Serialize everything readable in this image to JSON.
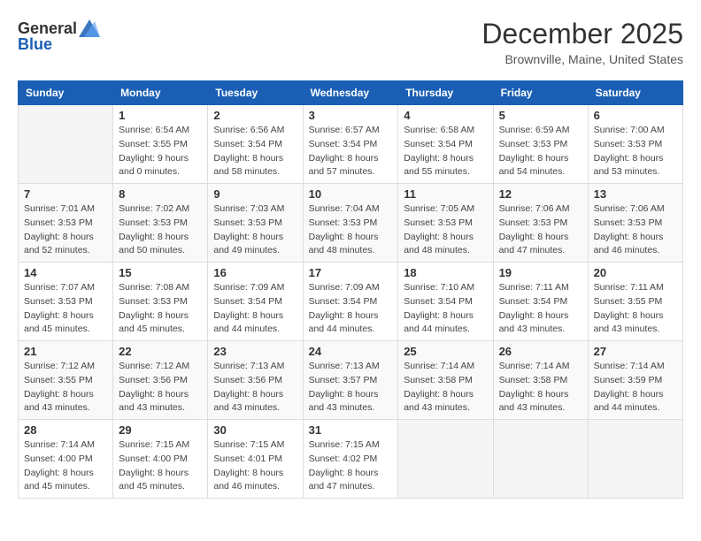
{
  "header": {
    "logo_line1": "General",
    "logo_line2": "Blue",
    "month": "December 2025",
    "location": "Brownville, Maine, United States"
  },
  "weekdays": [
    "Sunday",
    "Monday",
    "Tuesday",
    "Wednesday",
    "Thursday",
    "Friday",
    "Saturday"
  ],
  "weeks": [
    [
      {
        "day": "",
        "info": ""
      },
      {
        "day": "1",
        "info": "Sunrise: 6:54 AM\nSunset: 3:55 PM\nDaylight: 9 hours\nand 0 minutes."
      },
      {
        "day": "2",
        "info": "Sunrise: 6:56 AM\nSunset: 3:54 PM\nDaylight: 8 hours\nand 58 minutes."
      },
      {
        "day": "3",
        "info": "Sunrise: 6:57 AM\nSunset: 3:54 PM\nDaylight: 8 hours\nand 57 minutes."
      },
      {
        "day": "4",
        "info": "Sunrise: 6:58 AM\nSunset: 3:54 PM\nDaylight: 8 hours\nand 55 minutes."
      },
      {
        "day": "5",
        "info": "Sunrise: 6:59 AM\nSunset: 3:53 PM\nDaylight: 8 hours\nand 54 minutes."
      },
      {
        "day": "6",
        "info": "Sunrise: 7:00 AM\nSunset: 3:53 PM\nDaylight: 8 hours\nand 53 minutes."
      }
    ],
    [
      {
        "day": "7",
        "info": "Sunrise: 7:01 AM\nSunset: 3:53 PM\nDaylight: 8 hours\nand 52 minutes."
      },
      {
        "day": "8",
        "info": "Sunrise: 7:02 AM\nSunset: 3:53 PM\nDaylight: 8 hours\nand 50 minutes."
      },
      {
        "day": "9",
        "info": "Sunrise: 7:03 AM\nSunset: 3:53 PM\nDaylight: 8 hours\nand 49 minutes."
      },
      {
        "day": "10",
        "info": "Sunrise: 7:04 AM\nSunset: 3:53 PM\nDaylight: 8 hours\nand 48 minutes."
      },
      {
        "day": "11",
        "info": "Sunrise: 7:05 AM\nSunset: 3:53 PM\nDaylight: 8 hours\nand 48 minutes."
      },
      {
        "day": "12",
        "info": "Sunrise: 7:06 AM\nSunset: 3:53 PM\nDaylight: 8 hours\nand 47 minutes."
      },
      {
        "day": "13",
        "info": "Sunrise: 7:06 AM\nSunset: 3:53 PM\nDaylight: 8 hours\nand 46 minutes."
      }
    ],
    [
      {
        "day": "14",
        "info": "Sunrise: 7:07 AM\nSunset: 3:53 PM\nDaylight: 8 hours\nand 45 minutes."
      },
      {
        "day": "15",
        "info": "Sunrise: 7:08 AM\nSunset: 3:53 PM\nDaylight: 8 hours\nand 45 minutes."
      },
      {
        "day": "16",
        "info": "Sunrise: 7:09 AM\nSunset: 3:54 PM\nDaylight: 8 hours\nand 44 minutes."
      },
      {
        "day": "17",
        "info": "Sunrise: 7:09 AM\nSunset: 3:54 PM\nDaylight: 8 hours\nand 44 minutes."
      },
      {
        "day": "18",
        "info": "Sunrise: 7:10 AM\nSunset: 3:54 PM\nDaylight: 8 hours\nand 44 minutes."
      },
      {
        "day": "19",
        "info": "Sunrise: 7:11 AM\nSunset: 3:54 PM\nDaylight: 8 hours\nand 43 minutes."
      },
      {
        "day": "20",
        "info": "Sunrise: 7:11 AM\nSunset: 3:55 PM\nDaylight: 8 hours\nand 43 minutes."
      }
    ],
    [
      {
        "day": "21",
        "info": "Sunrise: 7:12 AM\nSunset: 3:55 PM\nDaylight: 8 hours\nand 43 minutes."
      },
      {
        "day": "22",
        "info": "Sunrise: 7:12 AM\nSunset: 3:56 PM\nDaylight: 8 hours\nand 43 minutes."
      },
      {
        "day": "23",
        "info": "Sunrise: 7:13 AM\nSunset: 3:56 PM\nDaylight: 8 hours\nand 43 minutes."
      },
      {
        "day": "24",
        "info": "Sunrise: 7:13 AM\nSunset: 3:57 PM\nDaylight: 8 hours\nand 43 minutes."
      },
      {
        "day": "25",
        "info": "Sunrise: 7:14 AM\nSunset: 3:58 PM\nDaylight: 8 hours\nand 43 minutes."
      },
      {
        "day": "26",
        "info": "Sunrise: 7:14 AM\nSunset: 3:58 PM\nDaylight: 8 hours\nand 43 minutes."
      },
      {
        "day": "27",
        "info": "Sunrise: 7:14 AM\nSunset: 3:59 PM\nDaylight: 8 hours\nand 44 minutes."
      }
    ],
    [
      {
        "day": "28",
        "info": "Sunrise: 7:14 AM\nSunset: 4:00 PM\nDaylight: 8 hours\nand 45 minutes."
      },
      {
        "day": "29",
        "info": "Sunrise: 7:15 AM\nSunset: 4:00 PM\nDaylight: 8 hours\nand 45 minutes."
      },
      {
        "day": "30",
        "info": "Sunrise: 7:15 AM\nSunset: 4:01 PM\nDaylight: 8 hours\nand 46 minutes."
      },
      {
        "day": "31",
        "info": "Sunrise: 7:15 AM\nSunset: 4:02 PM\nDaylight: 8 hours\nand 47 minutes."
      },
      {
        "day": "",
        "info": ""
      },
      {
        "day": "",
        "info": ""
      },
      {
        "day": "",
        "info": ""
      }
    ]
  ]
}
